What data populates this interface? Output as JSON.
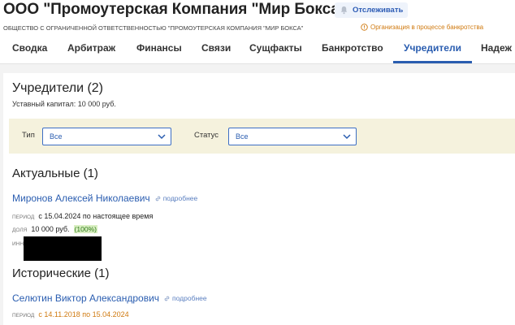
{
  "header": {
    "company_title": "ООО \"Промоутерская Компания \"Мир Бокса\"",
    "follow_label": "Отслеживать",
    "company_full_name": "ОБЩЕСТВО С ОГРАНИЧЕННОЙ ОТВЕТСТВЕННОСТЬЮ \"ПРОМОУТЕРСКАЯ КОМПАНИЯ \"МИР БОКСА\"",
    "status_text": "Организация в процессе банкротства",
    "status_color": "#d07a10"
  },
  "tabs": [
    {
      "label": "Сводка"
    },
    {
      "label": "Арбитраж"
    },
    {
      "label": "Финансы"
    },
    {
      "label": "Связи"
    },
    {
      "label": "Сущфакты"
    },
    {
      "label": "Банкротство"
    },
    {
      "label": "Учредители",
      "active": true
    },
    {
      "label": "Надеж"
    }
  ],
  "founders": {
    "title": "Учредители (2)",
    "capital": "Уставный капитал: 10 000 руб.",
    "filters": {
      "type_label": "Тип",
      "type_value": "Все",
      "status_label": "Статус",
      "status_value": "Все"
    },
    "current": {
      "title": "Актуальные (1)",
      "name": "Миронов Алексей Николаевич",
      "more": "подробнее",
      "period_key": "период",
      "period_value": "с 15.04.2024 по настоящее время",
      "share_key": "доля",
      "share_value": "10 000 руб.",
      "share_pct": "(100%)",
      "inn_key": "ИНН"
    },
    "historic": {
      "title": "Исторические (1)",
      "name": "Селютин Виктор Александрович",
      "more": "подробнее",
      "period_key": "период",
      "period_value": "с 14.11.2018 по 15.04.2024"
    }
  },
  "colors": {
    "accent": "#2a5db0",
    "filter_bg": "#f5f2dd",
    "warning": "#d07a10"
  }
}
